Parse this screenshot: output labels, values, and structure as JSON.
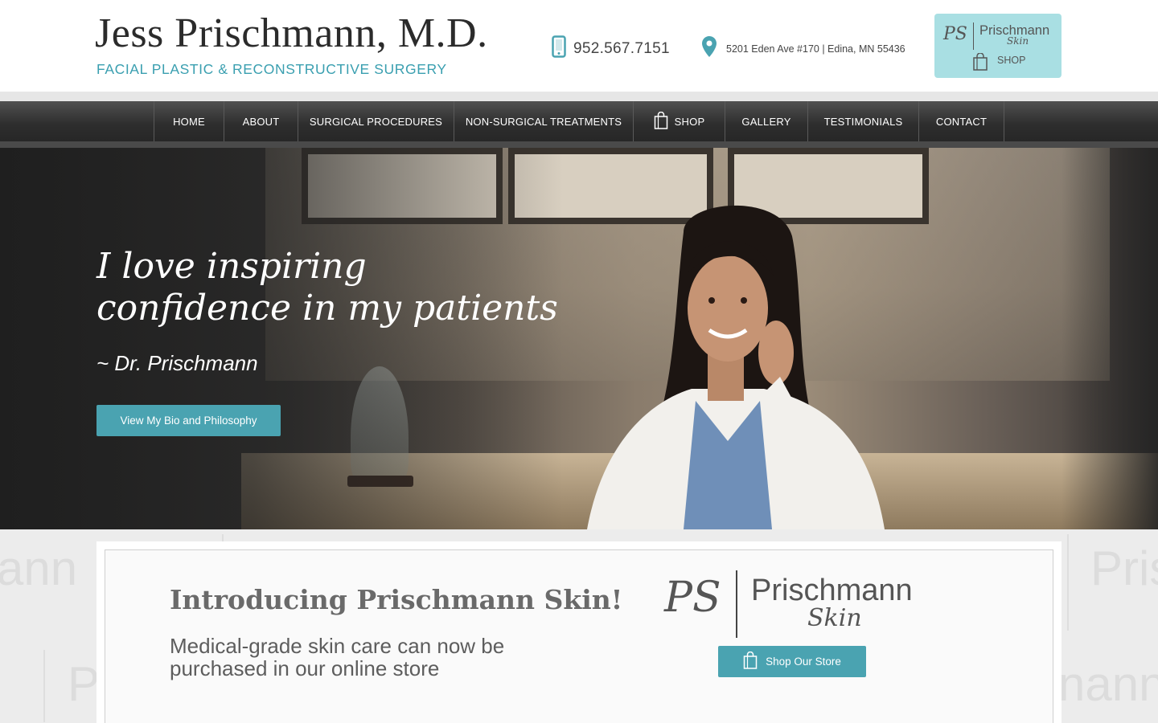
{
  "header": {
    "title": "Jess Prischmann, M.D.",
    "subtitle": "FACIAL PLASTIC & RECONSTRUCTIVE SURGERY",
    "phone": "952.567.7151",
    "address": "5201 Eden Ave #170 | Edina, MN 55436",
    "shop_badge": {
      "monogram": "PS",
      "brand": "Prischmann",
      "brand_sub": "Skin",
      "label": "SHOP"
    }
  },
  "nav": {
    "items": [
      {
        "label": "HOME"
      },
      {
        "label": "ABOUT"
      },
      {
        "label": "SURGICAL PROCEDURES"
      },
      {
        "label": "NON-SURGICAL TREATMENTS"
      },
      {
        "label": "SHOP",
        "icon": "shopping-bag-icon"
      },
      {
        "label": "GALLERY"
      },
      {
        "label": "TESTIMONIALS"
      },
      {
        "label": "CONTACT"
      }
    ]
  },
  "hero": {
    "quote_line1": "I love inspiring",
    "quote_line2": "confidence in my patients",
    "signature": "~ Dr. Prischmann",
    "button_label": "View My Bio and Philosophy"
  },
  "promo": {
    "title": "Introducing Prischmann Skin!",
    "text": "Medical-grade skin care can now be purchased in our online store",
    "logo": {
      "monogram": "PS",
      "name": "Prischmann",
      "sub": "Skin"
    },
    "button_label": "Shop Our Store",
    "watermark": [
      "ann",
      "Pris",
      "P",
      "nann"
    ]
  },
  "colors": {
    "accent": "#4aa3b1",
    "subtitle_teal": "#3a9fb0",
    "shop_badge_bg": "#a9dfe3",
    "nav_bg": "#2e2e2e"
  }
}
